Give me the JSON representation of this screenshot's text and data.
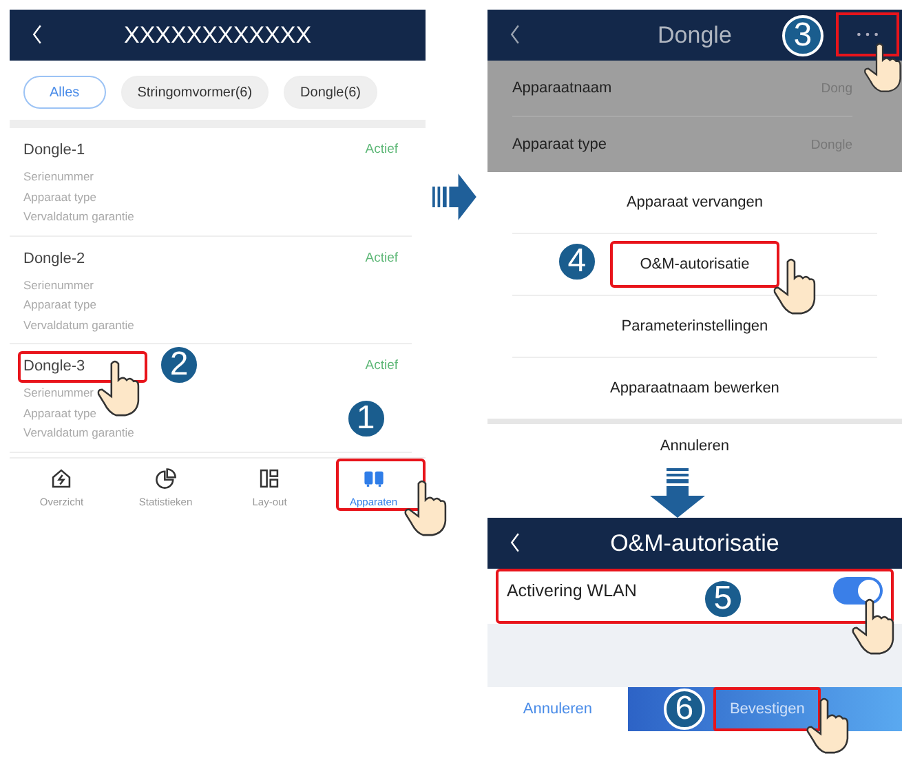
{
  "device_list": {
    "title": "XXXXXXXXXXXX",
    "filters": [
      {
        "label": "Alles",
        "selected": true
      },
      {
        "label": "Stringomvormer(6)",
        "selected": false
      },
      {
        "label": "Dongle(6)",
        "selected": false
      }
    ],
    "devices": [
      {
        "name": "Dongle-1",
        "status": "Actief",
        "fields": [
          "Serienummer",
          "Apparaat type",
          "Vervaldatum garantie"
        ]
      },
      {
        "name": "Dongle-2",
        "status": "Actief",
        "fields": [
          "Serienummer",
          "Apparaat type",
          "Vervaldatum garantie"
        ]
      },
      {
        "name": "Dongle-3",
        "status": "Actief",
        "fields": [
          "Serienummer",
          "Apparaat type",
          "Vervaldatum garantie"
        ],
        "step": "2"
      }
    ],
    "nav": [
      {
        "label": "Overzicht",
        "selected": false
      },
      {
        "label": "Statistieken",
        "selected": false
      },
      {
        "label": "Lay-out",
        "selected": false
      },
      {
        "label": "Apparaten",
        "selected": true,
        "step": "1"
      }
    ]
  },
  "device_detail": {
    "title": "Dongle",
    "more_step": "3",
    "properties": [
      {
        "label": "Apparaatnaam",
        "value": "Dong"
      },
      {
        "label": "Apparaat type",
        "value": "Dongle"
      }
    ],
    "menu": [
      {
        "label": "Apparaat vervangen"
      },
      {
        "label": "O&M-autorisatie",
        "step": "4"
      },
      {
        "label": "Parameterinstellingen"
      },
      {
        "label": "Apparaatnaam bewerken"
      }
    ],
    "cancel": "Annuleren"
  },
  "authorization": {
    "title": "O&M-autorisatie",
    "setting": {
      "label": "Activering WLAN",
      "on": true,
      "step": "5"
    },
    "cancel": "Annuleren",
    "confirm": "Bevestigen",
    "confirm_step": "6"
  }
}
